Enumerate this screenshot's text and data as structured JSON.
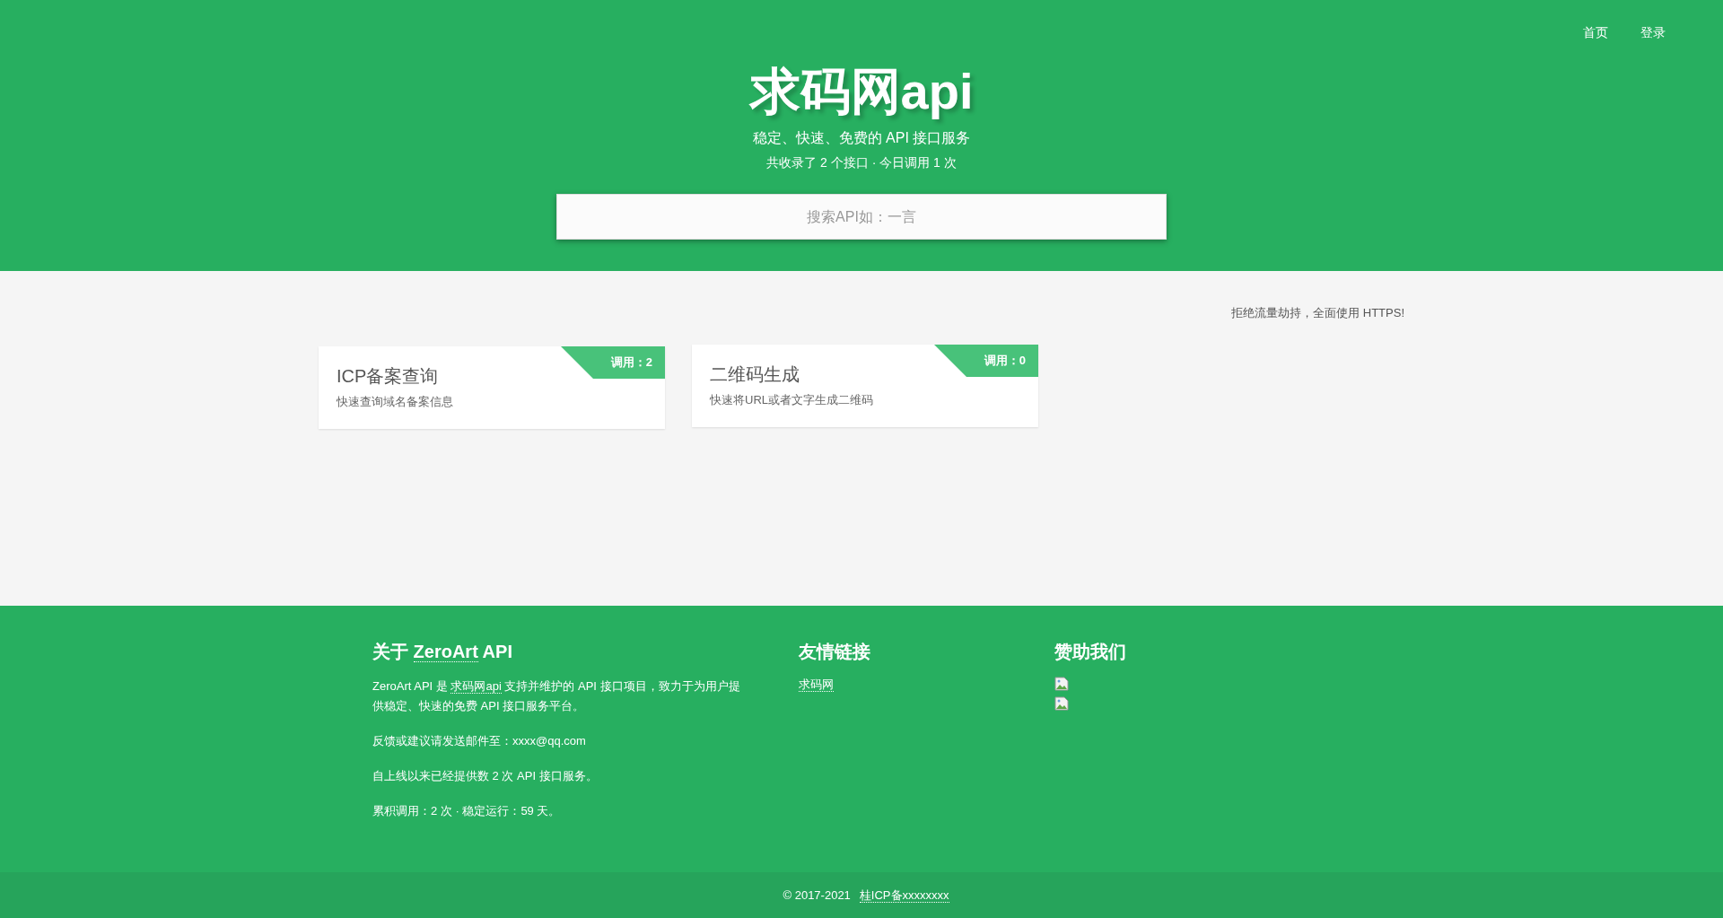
{
  "nav": [
    {
      "label": "首页"
    },
    {
      "label": "登录"
    }
  ],
  "title": "求码网api",
  "subtitle": "稳定、快速、免费的 API 接口服务",
  "stats": "共收录了 2 个接口 · 今日调用 1 次",
  "search": {
    "placeholder": "搜索API如：一言"
  },
  "notice": "拒绝流量劫持，全面使用 HTTPS!",
  "cards": [
    {
      "title": "ICP备案查询",
      "desc": "快速查询域名备案信息",
      "badge": "调用：2"
    },
    {
      "title": "二维码生成",
      "desc": "快速将URL或者文字生成二维码",
      "badge": "调用：0"
    }
  ],
  "footer": {
    "about": {
      "heading": {
        "before": "关于 ",
        "link": "ZeroArt",
        "after": " API"
      },
      "intro": {
        "before": "ZeroArt API 是 ",
        "link": "求码网api",
        "after": " 支持并维护的 API 接口项目，致力于为用户提供稳定、快速的免费 API 接口服务平台。"
      },
      "paragraphs": [
        "反馈或建议请发送邮件至：xxxx@qq.com",
        "自上线以来已经提供数 2 次 API 接口服务。",
        "累积调用：2 次 · 稳定运行：59 天。"
      ]
    },
    "links": {
      "heading": "友情链接",
      "items": [
        {
          "label": "求码网"
        }
      ]
    },
    "sponsor": {
      "heading": "赞助我们",
      "images": [
        {
          "kind": "broken-image"
        },
        {
          "kind": "broken-image"
        }
      ]
    }
  },
  "copyright": {
    "text": "© 2017-2021",
    "link": "桂ICP备xxxxxxxx"
  }
}
